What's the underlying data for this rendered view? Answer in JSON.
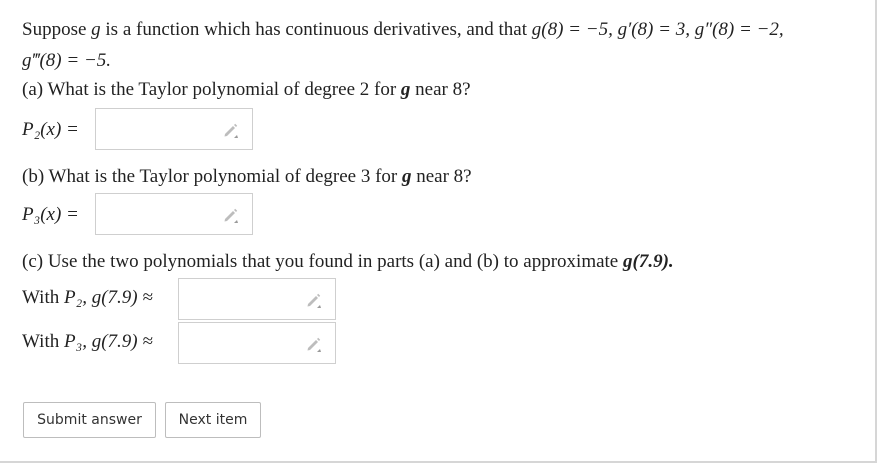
{
  "problem": {
    "intro_text_1": "Suppose ",
    "g": "g",
    "intro_text_2": " is a function which has continuous derivatives, and that ",
    "cond_1": "g(8) = −5, g′(8) = 3, g″(8) = −2,",
    "cond_2": "g‴(8) = −5."
  },
  "part_a": {
    "prompt_pre": "(a) What is the Taylor polynomial of degree 2 for ",
    "prompt_g": "g",
    "prompt_post": " near 8?",
    "label": "P₂(x) =",
    "value": ""
  },
  "part_b": {
    "prompt_pre": "(b) What is the Taylor polynomial of degree 3 for ",
    "prompt_g": "g",
    "prompt_post": " near 8?",
    "label": "P₃(x) =",
    "value": ""
  },
  "part_c": {
    "prompt_pre": "(c) Use the two polynomials that you found in parts (a) and (b) to approximate ",
    "prompt_expr": "g(7.9).",
    "with_p2_pre": "With ",
    "with_p2_math": "P₂, g(7.9) ≈",
    "with_p3_pre": "With ",
    "with_p3_math": "P₃, g(7.9) ≈",
    "value_p2": "",
    "value_p3": ""
  },
  "buttons": {
    "submit": "Submit answer",
    "next": "Next item"
  },
  "icons": {
    "edit": "pencil-icon"
  }
}
